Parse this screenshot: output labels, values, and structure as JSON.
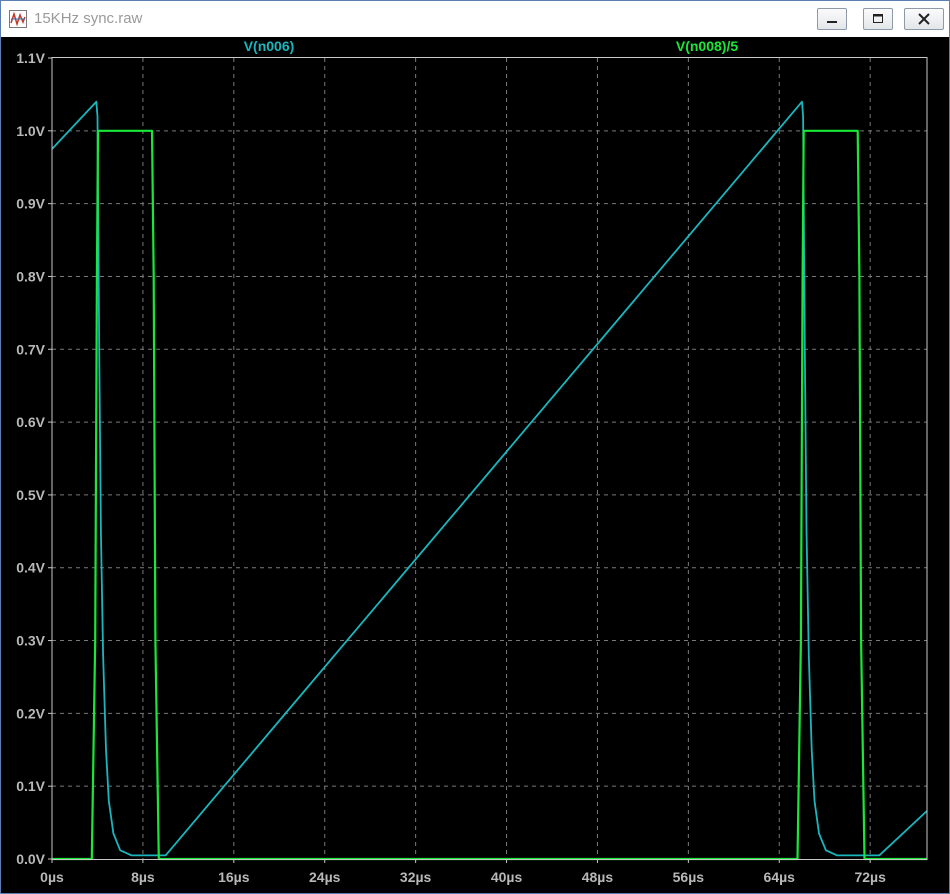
{
  "window": {
    "title": "15KHz sync.raw",
    "icons": {
      "app": "waveform-viewer-icon",
      "minimize": "minimize-icon",
      "maximize": "maximize-icon",
      "close": "close-icon"
    }
  },
  "colors": {
    "background": "#000000",
    "grid": "#7a7a7a",
    "axis_text": "#b8b8b8",
    "frame": "#c8c8c8",
    "cyan": "#1ab6be",
    "green": "#19e838"
  },
  "chart_data": {
    "type": "line",
    "xlabel": "",
    "ylabel": "",
    "xlim": [
      0,
      77
    ],
    "ylim": [
      0,
      1.1
    ],
    "x_unit": "µs",
    "grid": true,
    "x_ticks": [
      {
        "value": 0,
        "label": "0µs"
      },
      {
        "value": 8,
        "label": "8µs"
      },
      {
        "value": 16,
        "label": "16µs"
      },
      {
        "value": 24,
        "label": "24µs"
      },
      {
        "value": 32,
        "label": "32µs"
      },
      {
        "value": 40,
        "label": "40µs"
      },
      {
        "value": 48,
        "label": "48µs"
      },
      {
        "value": 56,
        "label": "56µs"
      },
      {
        "value": 64,
        "label": "64µs"
      },
      {
        "value": 72,
        "label": "72µs"
      }
    ],
    "y_ticks": [
      {
        "value": 0.0,
        "label": "0.0V"
      },
      {
        "value": 0.1,
        "label": "0.1V"
      },
      {
        "value": 0.2,
        "label": "0.2V"
      },
      {
        "value": 0.3,
        "label": "0.3V"
      },
      {
        "value": 0.4,
        "label": "0.4V"
      },
      {
        "value": 0.5,
        "label": "0.5V"
      },
      {
        "value": 0.6,
        "label": "0.6V"
      },
      {
        "value": 0.7,
        "label": "0.7V"
      },
      {
        "value": 0.8,
        "label": "0.8V"
      },
      {
        "value": 0.9,
        "label": "0.9V"
      },
      {
        "value": 1.0,
        "label": "1.0V"
      },
      {
        "value": 1.1,
        "label": "1.1V"
      }
    ],
    "series": [
      {
        "name": "V(n006)",
        "color": "#1ab6be",
        "points": [
          [
            0,
            0.975
          ],
          [
            3.9,
            1.04
          ],
          [
            4.0,
            1.02
          ],
          [
            4.15,
            0.7
          ],
          [
            4.3,
            0.45
          ],
          [
            4.5,
            0.28
          ],
          [
            4.75,
            0.15
          ],
          [
            5.0,
            0.08
          ],
          [
            5.4,
            0.035
          ],
          [
            6.0,
            0.012
          ],
          [
            7.0,
            0.005
          ],
          [
            9.5,
            0.005
          ],
          [
            10.0,
            0.005
          ],
          [
            66.0,
            1.04
          ],
          [
            66.1,
            1.02
          ],
          [
            66.25,
            0.7
          ],
          [
            66.4,
            0.45
          ],
          [
            66.6,
            0.28
          ],
          [
            66.85,
            0.15
          ],
          [
            67.1,
            0.08
          ],
          [
            67.5,
            0.035
          ],
          [
            68.1,
            0.012
          ],
          [
            69.1,
            0.005
          ],
          [
            72.8,
            0.005
          ],
          [
            77.0,
            0.066
          ]
        ]
      },
      {
        "name": "V(n008)/5",
        "color": "#19e838",
        "points": [
          [
            0,
            0
          ],
          [
            3.5,
            0
          ],
          [
            3.8,
            0.3
          ],
          [
            3.95,
            0.8
          ],
          [
            4.05,
            1.0
          ],
          [
            8.8,
            1.0
          ],
          [
            8.95,
            0.8
          ],
          [
            9.1,
            0.3
          ],
          [
            9.4,
            0
          ],
          [
            65.6,
            0
          ],
          [
            65.9,
            0.3
          ],
          [
            66.05,
            0.8
          ],
          [
            66.15,
            1.0
          ],
          [
            70.9,
            1.0
          ],
          [
            71.05,
            0.8
          ],
          [
            71.2,
            0.3
          ],
          [
            71.5,
            0
          ],
          [
            77.0,
            0
          ]
        ]
      }
    ]
  }
}
